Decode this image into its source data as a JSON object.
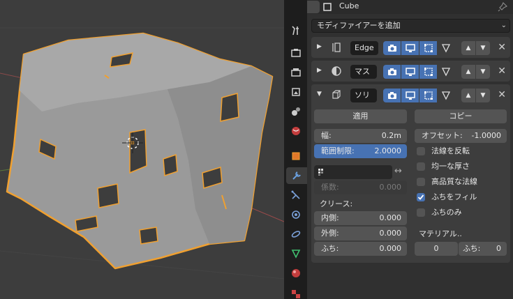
{
  "header": {
    "object_name": "Cube"
  },
  "add_modifier": {
    "label": "モディファイアーを追加"
  },
  "modifiers": [
    {
      "name": "Edge",
      "icon": "edge-split-icon",
      "expanded": false
    },
    {
      "name": "マス",
      "icon": "subsurf-icon",
      "expanded": false
    },
    {
      "name": "ソリ",
      "icon": "solidify-icon",
      "expanded": true
    }
  ],
  "solidify": {
    "apply_label": "適用",
    "copy_label": "コピー",
    "thickness_label": "幅:",
    "thickness_value": "0.2m",
    "offset_label": "オフセット:",
    "offset_value": "-1.0000",
    "clamp_label": "範囲制限:",
    "clamp_value": "2.0000",
    "flip_normals": "法線を反転",
    "even_thickness": "均一な厚さ",
    "high_quality_normals": "高品質な法線",
    "fill_rim": "ふちをフィル",
    "only_rim": "ふちのみ",
    "factor_label": "係数:",
    "factor_value": "0.000",
    "crease_label": "クリース:",
    "inner_label": "内側:",
    "inner_value": "0.000",
    "outer_label": "外側:",
    "outer_value": "0.000",
    "rim_label": "ふち:",
    "rim_value": "0.000",
    "material_label": "マテリアル..",
    "material_value": "0",
    "material_rim_label": "ふち:",
    "material_rim_value": "0",
    "checks": {
      "flip_normals": false,
      "even_thickness": false,
      "high_quality_normals": false,
      "fill_rim": true,
      "only_rim": false
    }
  },
  "colors": {
    "accent": "#4772b3",
    "selection_outline": "#f0a030",
    "panel": "#3d3d3d",
    "background": "#303030"
  }
}
